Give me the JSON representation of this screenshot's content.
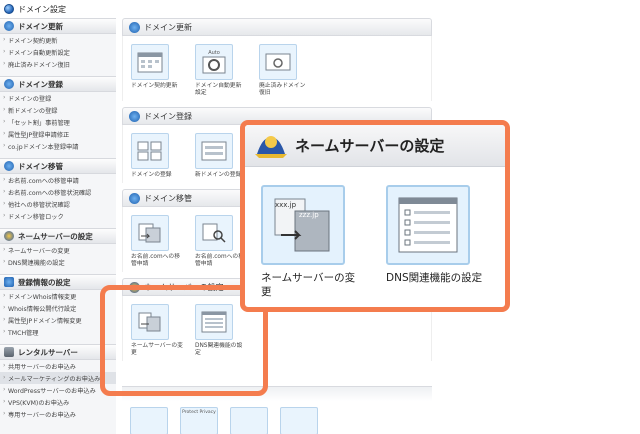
{
  "header": {
    "title": "ドメイン設定"
  },
  "sidebar": {
    "groups": [
      {
        "title": "ドメイン更新",
        "items": [
          "ドメイン契約更新",
          "ドメイン自動更新設定",
          "廃止済みドメイン復旧"
        ]
      },
      {
        "title": "ドメイン登録",
        "items": [
          "ドメインの登録",
          "新ドメインの登録",
          "「セット割」事前管理",
          "属性型JP登録申請修正",
          "co.jpドメイン本登録申請"
        ]
      },
      {
        "title": "ドメイン移管",
        "items": [
          "お名前.comへの移管申請",
          "お名前.comへの移管状況確認",
          "他社への移管状況確認",
          "ドメイン移管ロック"
        ]
      },
      {
        "title": "ネームサーバーの設定",
        "items": [
          "ネームサーバーの変更",
          "DNS関連機能の設定"
        ]
      },
      {
        "title": "登録情報の設定",
        "items": [
          "ドメインWhois情報変更",
          "Whois情報公開代行設定",
          "属性型JPドメイン情報変更",
          "TMCH管理"
        ]
      },
      {
        "title": "レンタルサーバー",
        "items": [
          "共用サーバーのお申込み",
          "メールマーケティングのお申込み",
          "WordPressサーバーのお申込み",
          "VPS(KVM)のお申込み",
          "専用サーバーのお申込み"
        ]
      }
    ]
  },
  "main": {
    "sections": [
      {
        "title": "ドメイン更新",
        "tiles": [
          {
            "label": "ドメイン契約更新",
            "tag": ""
          },
          {
            "label": "ドメイン自動更新設定",
            "tag": "Auto"
          },
          {
            "label": "廃止済みドメイン復旧",
            "tag": ""
          }
        ]
      },
      {
        "title": "ドメイン登録",
        "tiles": [
          {
            "label": "ドメインの登録"
          },
          {
            "label": "新ドメインの登録"
          }
        ]
      },
      {
        "title": "ドメイン移管",
        "tiles": [
          {
            "label": "お名前.comへの移管申請"
          },
          {
            "label": "お名前.comへの移管申請"
          }
        ]
      },
      {
        "title": "ネームサーバーの設定",
        "tiles": [
          {
            "label": "ネームサーバーの変更"
          },
          {
            "label": "DNS関連機能の設定"
          }
        ]
      }
    ],
    "bottom_tag": "Protect Privacy"
  },
  "callout": {
    "title": "ネームサーバーの設定",
    "tiles": [
      {
        "label": "ネームサーバーの変更",
        "tags": [
          "xxx.jp",
          "zzz.jp"
        ]
      },
      {
        "label": "DNS関連機能の設定"
      }
    ]
  },
  "colors": {
    "highlight": "#f47c4e",
    "tile_border": "#a8cdeb",
    "tile_fill": "#e4f2fd"
  }
}
